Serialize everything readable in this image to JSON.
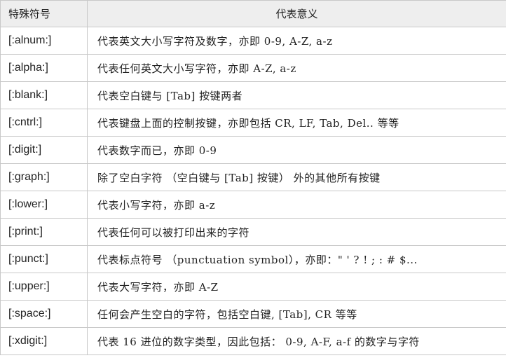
{
  "table": {
    "headers": [
      "特殊符号",
      "代表意义"
    ],
    "rows": [
      {
        "symbol": "[:alnum:]",
        "meaning": "代表英文大小写字符及数字，亦即 0-9, A-Z, a-z"
      },
      {
        "symbol": "[:alpha:]",
        "meaning": "代表任何英文大小写字符，亦即 A-Z, a-z"
      },
      {
        "symbol": "[:blank:]",
        "meaning": "代表空白键与 [Tab] 按键两者"
      },
      {
        "symbol": "[:cntrl:]",
        "meaning": "代表键盘上面的控制按键，亦即包括 CR, LF, Tab, Del.. 等等"
      },
      {
        "symbol": "[:digit:]",
        "meaning": "代表数字而已，亦即 0-9"
      },
      {
        "symbol": "[:graph:]",
        "meaning": "除了空白字符 （空白键与 [Tab] 按键） 外的其他所有按键"
      },
      {
        "symbol": "[:lower:]",
        "meaning": "代表小写字符，亦即 a-z"
      },
      {
        "symbol": "[:print:]",
        "meaning": "代表任何可以被打印出来的字符"
      },
      {
        "symbol": "[:punct:]",
        "meaning": "代表标点符号 （punctuation symbol），亦即：\" ' ? ! ; : # $..."
      },
      {
        "symbol": "[:upper:]",
        "meaning": "代表大写字符，亦即 A-Z"
      },
      {
        "symbol": "[:space:]",
        "meaning": "任何会产生空白的字符，包括空白键, [Tab], CR 等等"
      },
      {
        "symbol": "[:xdigit:]",
        "meaning": "代表 16 进位的数字类型，因此包括： 0-9, A-F, a-f 的数字与字符"
      }
    ]
  }
}
